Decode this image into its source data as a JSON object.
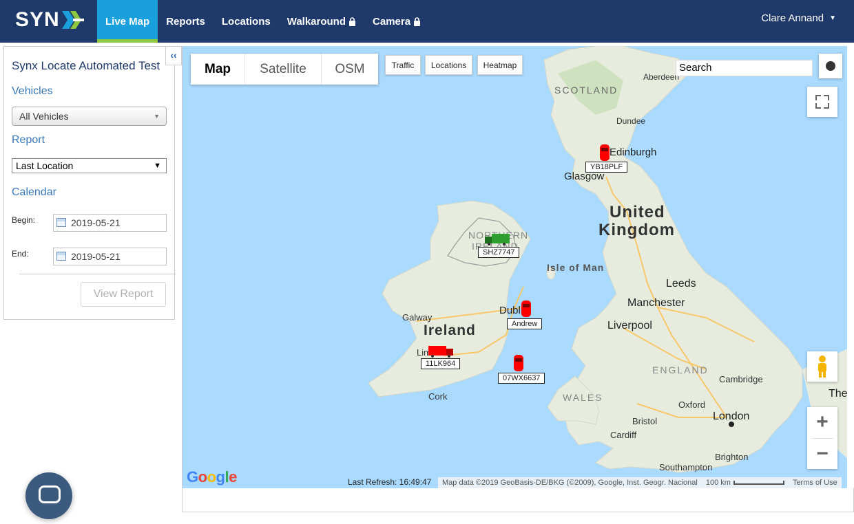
{
  "brand": {
    "logo_text": "SYN",
    "accent_green": "#8dc63f",
    "accent_blue": "#1aa0dc",
    "nav_bg": "#1f3a6a"
  },
  "nav": {
    "items": [
      {
        "label": "Live Map",
        "active": true
      },
      {
        "label": "Reports"
      },
      {
        "label": "Locations"
      },
      {
        "label": "Walkaround",
        "locked": true
      },
      {
        "label": "Camera",
        "locked": true
      }
    ],
    "lock_icon": "lock-icon",
    "user": "Clare Annand"
  },
  "panel": {
    "collapse": "‹‹",
    "title": "Synx Locate Automated Test",
    "vehicles_label": "Vehicles",
    "vehicles_value": "All Vehicles",
    "report_label": "Report",
    "report_value": "Last Location",
    "calendar_label": "Calendar",
    "begin_label": "Begin:",
    "begin_value": "2019-05-21",
    "end_label": "End:",
    "end_value": "2019-05-21",
    "view_report": "View Report"
  },
  "map": {
    "types": [
      "Map",
      "Satellite",
      "OSM"
    ],
    "active_type": "Map",
    "layers": [
      "Traffic",
      "Locations",
      "Heatmap"
    ],
    "search_value": "Search",
    "labels": {
      "scotland": "SCOTLAND",
      "aberdeen": "Aberdeen",
      "dundee": "Dundee",
      "edinburgh": "Edinburgh",
      "glasgow": "Glasgow",
      "united": "United",
      "kingdom": "Kingdom",
      "northern": "NORTHERN",
      "ireland_ni": "IRELAND",
      "isle_of_man": "Isle of Man",
      "leeds": "Leeds",
      "manchester": "Manchester",
      "liverpool": "Liverpool",
      "galway": "Galway",
      "ireland": "Ireland",
      "dublin": "Dublin",
      "limerick": "Limerick",
      "cork": "Cork",
      "england": "ENGLAND",
      "cambridge": "Cambridge",
      "wales": "WALES",
      "oxford": "Oxford",
      "bristol": "Bristol",
      "cardiff": "Cardiff",
      "london": "London",
      "brighton": "Brighton",
      "southampton": "Southampton",
      "the": "The"
    },
    "vehicles": [
      {
        "label": "YB18PLF",
        "color": "#ff0000",
        "kind": "car"
      },
      {
        "label": "SHZ7747",
        "color": "#2e9e2e",
        "kind": "truck"
      },
      {
        "label": "Andrew",
        "color": "#ff0000",
        "kind": "car"
      },
      {
        "label": "11LK964",
        "color": "#ff0000",
        "kind": "truck"
      },
      {
        "label": "07WX6637",
        "color": "#ff0000",
        "kind": "car"
      }
    ],
    "google": "Google",
    "last_refresh": "Last Refresh:  16:49:47",
    "attribution": "Map data ©2019 GeoBasis-DE/BKG (©2009), Google, Inst. Geogr. Nacional",
    "scale": "100 km",
    "terms": "Terms of Use",
    "zoom_in": "+",
    "zoom_out": "−"
  }
}
